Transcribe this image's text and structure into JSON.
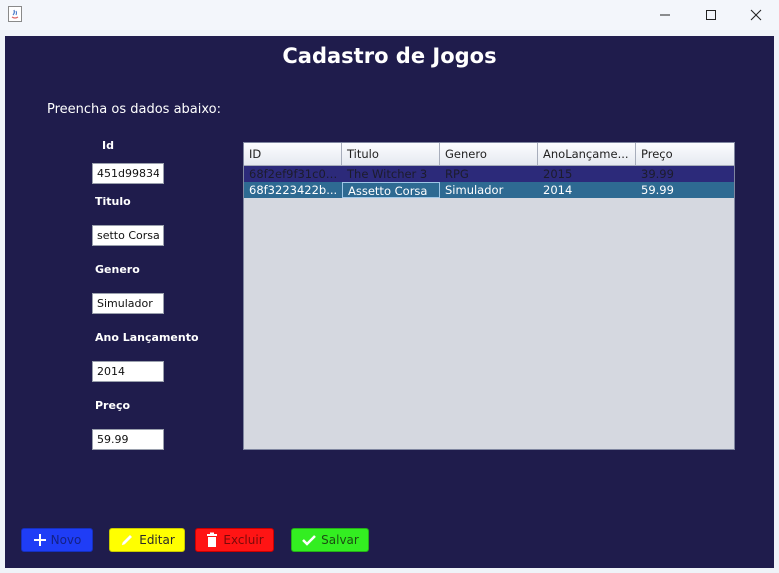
{
  "window": {
    "minimize_glyph": "—",
    "maximize_glyph": "☐",
    "close_glyph": "✕"
  },
  "header": {
    "title": "Cadastro de Jogos",
    "instructions": "Preencha os dados abaixo:"
  },
  "form": {
    "id_label": "Id",
    "id_value": "451d99834",
    "titulo_label": "Titulo",
    "titulo_value": "setto Corsa",
    "genero_label": "Genero",
    "genero_value": "Simulador",
    "ano_label": "Ano Lançamento",
    "ano_value": "2014",
    "preco_label": "Preço",
    "preco_value": "59.99"
  },
  "table": {
    "columns": [
      "ID",
      "Titulo",
      "Genero",
      "AnoLançame...",
      "Preço"
    ],
    "rows": [
      [
        "68f2ef9f31c0b...",
        "The Witcher 3",
        "RPG",
        "2015",
        "39.99"
      ],
      [
        "68f3223422b...",
        "Assetto Corsa",
        "Simulador",
        "2014",
        "59.99"
      ]
    ]
  },
  "buttons": {
    "novo": {
      "label": "Novo",
      "icon": "plus-icon",
      "color": "#1f3df6",
      "text_color": "#142187"
    },
    "editar": {
      "label": "Editar",
      "icon": "pencil-icon",
      "color": "#ffff00",
      "text_color": "#2a2a2a"
    },
    "excluir": {
      "label": "Excluir",
      "icon": "trash-icon",
      "color": "#ff1414",
      "text_color": "#7a0a0a"
    },
    "salvar": {
      "label": "Salvar",
      "icon": "check-icon",
      "color": "#33ee21",
      "text_color": "#1b4f12"
    }
  }
}
